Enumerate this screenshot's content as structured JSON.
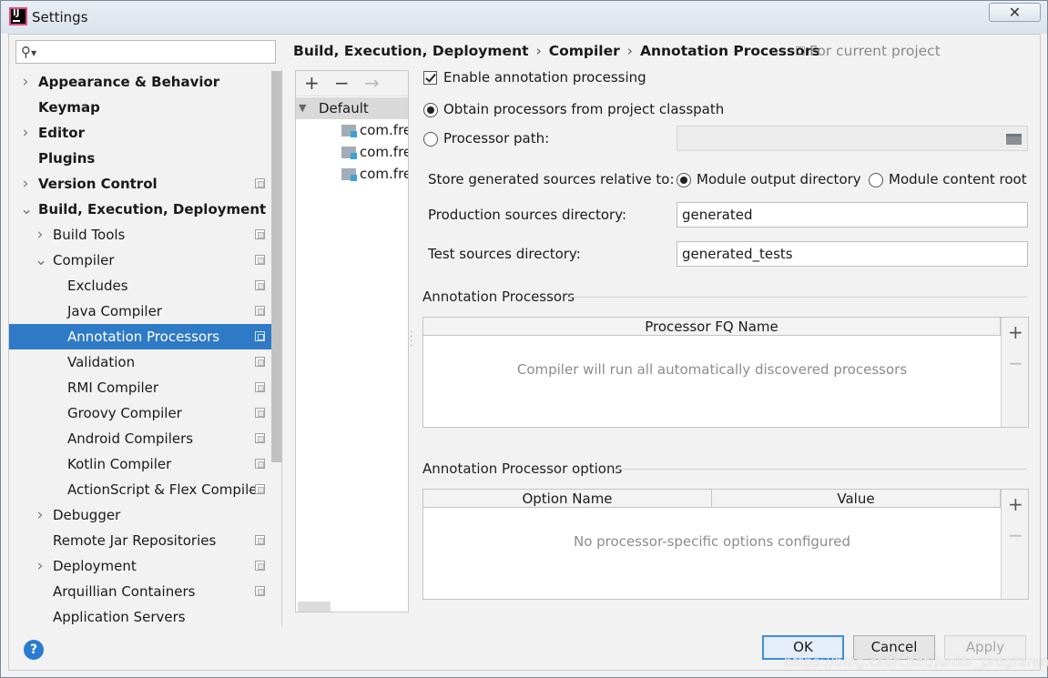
{
  "window": {
    "title": "Settings",
    "close_glyph": "✕"
  },
  "sidebar": {
    "search_placeholder": "",
    "items": [
      {
        "label": "Appearance & Behavior",
        "level": 0,
        "expander": "collapsed",
        "bold": true,
        "project_icon": false
      },
      {
        "label": "Keymap",
        "level": 0,
        "expander": "none",
        "bold": true,
        "project_icon": false
      },
      {
        "label": "Editor",
        "level": 0,
        "expander": "collapsed",
        "bold": true,
        "project_icon": false
      },
      {
        "label": "Plugins",
        "level": 0,
        "expander": "none",
        "bold": true,
        "project_icon": false
      },
      {
        "label": "Version Control",
        "level": 0,
        "expander": "collapsed",
        "bold": true,
        "project_icon": true
      },
      {
        "label": "Build, Execution, Deployment",
        "level": 0,
        "expander": "expanded",
        "bold": true,
        "project_icon": false
      },
      {
        "label": "Build Tools",
        "level": 1,
        "expander": "collapsed",
        "bold": false,
        "project_icon": true
      },
      {
        "label": "Compiler",
        "level": 1,
        "expander": "expanded",
        "bold": false,
        "project_icon": true
      },
      {
        "label": "Excludes",
        "level": 2,
        "expander": "none",
        "bold": false,
        "project_icon": true
      },
      {
        "label": "Java Compiler",
        "level": 2,
        "expander": "none",
        "bold": false,
        "project_icon": true
      },
      {
        "label": "Annotation Processors",
        "level": 2,
        "expander": "none",
        "bold": false,
        "project_icon": true,
        "selected": true
      },
      {
        "label": "Validation",
        "level": 2,
        "expander": "none",
        "bold": false,
        "project_icon": true
      },
      {
        "label": "RMI Compiler",
        "level": 2,
        "expander": "none",
        "bold": false,
        "project_icon": true
      },
      {
        "label": "Groovy Compiler",
        "level": 2,
        "expander": "none",
        "bold": false,
        "project_icon": true
      },
      {
        "label": "Android Compilers",
        "level": 2,
        "expander": "none",
        "bold": false,
        "project_icon": true
      },
      {
        "label": "Kotlin Compiler",
        "level": 2,
        "expander": "none",
        "bold": false,
        "project_icon": true
      },
      {
        "label": "ActionScript & Flex Compile",
        "level": 2,
        "expander": "none",
        "bold": false,
        "project_icon": true
      },
      {
        "label": "Debugger",
        "level": 1,
        "expander": "collapsed",
        "bold": false,
        "project_icon": false
      },
      {
        "label": "Remote Jar Repositories",
        "level": 1,
        "expander": "none",
        "bold": false,
        "project_icon": true
      },
      {
        "label": "Deployment",
        "level": 1,
        "expander": "collapsed",
        "bold": false,
        "project_icon": true
      },
      {
        "label": "Arquillian Containers",
        "level": 1,
        "expander": "none",
        "bold": false,
        "project_icon": true
      },
      {
        "label": "Application Servers",
        "level": 1,
        "expander": "none",
        "bold": false,
        "project_icon": false
      }
    ]
  },
  "breadcrumb": {
    "parts": [
      "Build, Execution, Deployment",
      "Compiler",
      "Annotation Processors"
    ],
    "separator": "›",
    "scope": "For current project"
  },
  "profiles": {
    "toolbar": {
      "add": "+",
      "remove": "−",
      "move": "→"
    },
    "default_label": "Default",
    "modules": [
      "com.fre",
      "com.fre",
      "com.fre"
    ]
  },
  "form": {
    "enable_label": "Enable annotation processing",
    "enable_checked": true,
    "obtain_label": "Obtain processors from project classpath",
    "obtain_selected": true,
    "path_label": "Processor path:",
    "path_value": "",
    "store_label": "Store generated sources relative to:",
    "module_output_label": "Module output directory",
    "module_output_selected": true,
    "module_content_label": "Module content root",
    "prod_label": "Production sources directory:",
    "prod_value": "generated",
    "test_label": "Test sources directory:",
    "test_value": "generated_tests"
  },
  "processors_section": {
    "title": "Annotation Processors",
    "column": "Processor FQ Name",
    "empty_text": "Compiler will run all automatically discovered processors",
    "add": "+",
    "remove": "−"
  },
  "options_section": {
    "title": "Annotation Processor options",
    "col_name": "Option Name",
    "col_value": "Value",
    "empty_text": "No processor-specific options configured",
    "add": "+",
    "remove": "−"
  },
  "buttons": {
    "help": "?",
    "ok": "OK",
    "cancel": "Cancel",
    "apply": "Apply"
  },
  "watermark": "https://blog.csdn.net/junior_programmer",
  "colors": {
    "selection": "#2f7ac6",
    "default_button_border": "#3b8de0"
  }
}
